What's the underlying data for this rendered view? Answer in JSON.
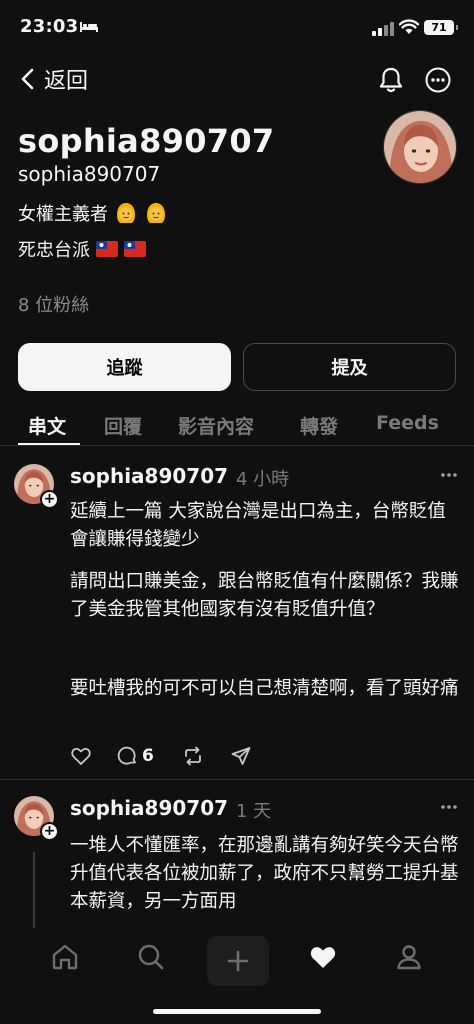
{
  "status_bar": {
    "time": "23:03",
    "battery": "71"
  },
  "nav": {
    "back_label": "返回"
  },
  "profile": {
    "display_name": "sophia890707",
    "handle": "sophia890707",
    "bio_line1": "女權主義者",
    "bio_line2": "死忠台派",
    "followers": "8 位粉絲",
    "follow_button": "追蹤",
    "mention_button": "提及"
  },
  "tabs": [
    {
      "label": "串文"
    },
    {
      "label": "回覆"
    },
    {
      "label": "影音內容"
    },
    {
      "label": "轉發"
    },
    {
      "label": "Feeds"
    }
  ],
  "posts": [
    {
      "author": "sophia890707",
      "time": "4 小時",
      "paragraphs": [
        "延續上一篇 大家說台灣是出口為主，台幣貶值會讓賺得錢變少",
        "請問出口賺美金，跟台幣貶值有什麼關係？我賺了美金我管其他國家有沒有貶值升值？",
        "要吐槽我的可不可以自己想清楚啊，看了頭好痛"
      ],
      "comment_count": "6"
    },
    {
      "author": "sophia890707",
      "time": "1 天",
      "paragraphs": [
        "一堆人不懂匯率，在那邊亂講有夠好笑今天台幣升值代表各位被加薪了，政府不只幫勞工提升基本薪資，另一方面用"
      ]
    }
  ],
  "icons": {
    "back": "chevron-left-icon",
    "bell": "bell-icon",
    "more": "more-icon",
    "like": "heart-icon",
    "comment": "comment-icon",
    "repost": "repost-icon",
    "share": "share-icon",
    "home": "home-icon",
    "search": "search-icon",
    "create": "plus-icon",
    "activity": "heart-filled-icon",
    "profile": "person-icon"
  },
  "colors": {
    "background": "#101010",
    "text": "#f3f5f7",
    "muted": "#7a7a7a"
  }
}
